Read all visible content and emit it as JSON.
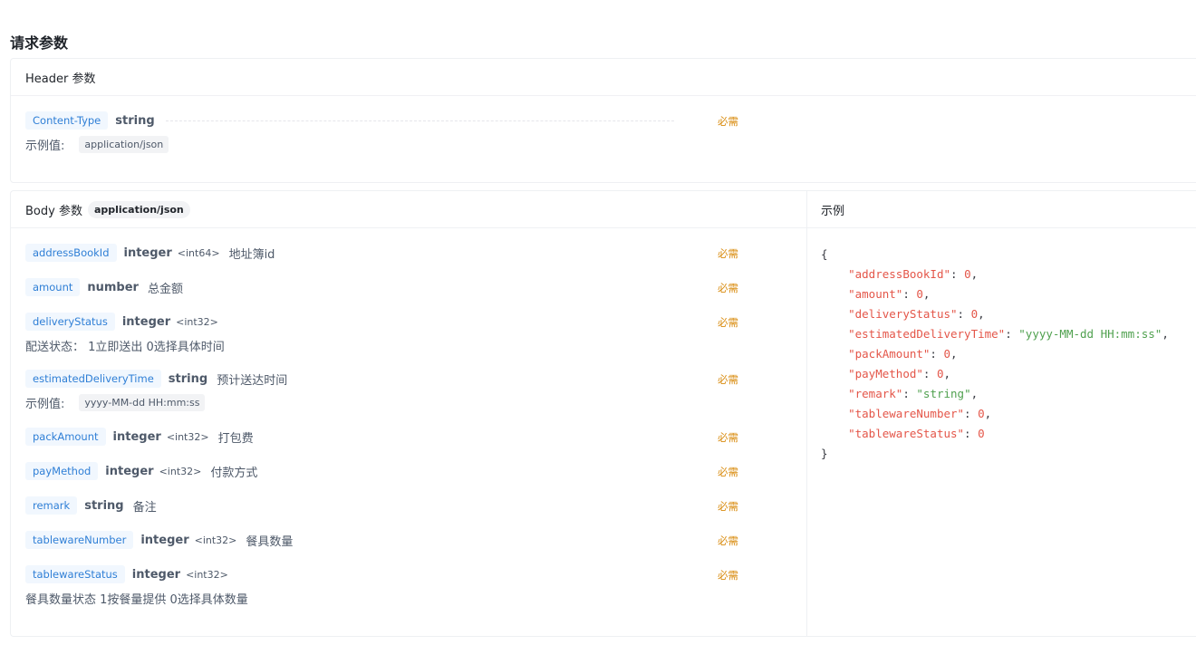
{
  "section_title": "请求参数",
  "header_section": {
    "title": "Header 参数",
    "params": [
      {
        "name": "Content-Type",
        "type": "string",
        "required": "必需",
        "example_label": "示例值:",
        "example": "application/json"
      }
    ]
  },
  "body_section": {
    "title": "Body 参数",
    "content_type": "application/json",
    "params": [
      {
        "name": "addressBookId",
        "type": "integer",
        "format": "<int64>",
        "desc": "地址簿id",
        "required": "必需"
      },
      {
        "name": "amount",
        "type": "number",
        "format": "",
        "desc": "总金额",
        "required": "必需"
      },
      {
        "name": "deliveryStatus",
        "type": "integer",
        "format": "<int32>",
        "desc": "",
        "sub": "配送状态： 1立即送出 0选择具体时间",
        "required": "必需"
      },
      {
        "name": "estimatedDeliveryTime",
        "type": "string",
        "format": "",
        "desc": "预计送达时间",
        "example_label": "示例值:",
        "example": "yyyy-MM-dd HH:mm:ss",
        "required": "必需"
      },
      {
        "name": "packAmount",
        "type": "integer",
        "format": "<int32>",
        "desc": "打包费",
        "required": "必需"
      },
      {
        "name": "payMethod",
        "type": "integer",
        "format": "<int32>",
        "desc": "付款方式",
        "required": "必需"
      },
      {
        "name": "remark",
        "type": "string",
        "format": "",
        "desc": "备注",
        "required": "必需"
      },
      {
        "name": "tablewareNumber",
        "type": "integer",
        "format": "<int32>",
        "desc": "餐具数量",
        "required": "必需"
      },
      {
        "name": "tablewareStatus",
        "type": "integer",
        "format": "<int32>",
        "desc": "",
        "sub": "餐具数量状态 1按餐量提供 0选择具体数量",
        "required": "必需"
      }
    ]
  },
  "example_section": {
    "title": "示例",
    "open_brace": "{",
    "close_brace": "}",
    "lines": [
      {
        "key": "\"addressBookId\"",
        "value": "0",
        "value_kind": "number",
        "comma": ","
      },
      {
        "key": "\"amount\"",
        "value": "0",
        "value_kind": "number",
        "comma": ","
      },
      {
        "key": "\"deliveryStatus\"",
        "value": "0",
        "value_kind": "number",
        "comma": ","
      },
      {
        "key": "\"estimatedDeliveryTime\"",
        "value": "\"yyyy-MM-dd HH:mm:ss\"",
        "value_kind": "string",
        "comma": ","
      },
      {
        "key": "\"packAmount\"",
        "value": "0",
        "value_kind": "number",
        "comma": ","
      },
      {
        "key": "\"payMethod\"",
        "value": "0",
        "value_kind": "number",
        "comma": ","
      },
      {
        "key": "\"remark\"",
        "value": "\"string\"",
        "value_kind": "string",
        "comma": ","
      },
      {
        "key": "\"tablewareNumber\"",
        "value": "0",
        "value_kind": "number",
        "comma": ","
      },
      {
        "key": "\"tablewareStatus\"",
        "value": "0",
        "value_kind": "number",
        "comma": ""
      }
    ]
  },
  "colors": {
    "param_name_text": "#2f7fd6",
    "param_name_bg": "#f1f7fe",
    "required": "#d98c10",
    "json_key": "#e45649",
    "json_string": "#50a14f"
  }
}
